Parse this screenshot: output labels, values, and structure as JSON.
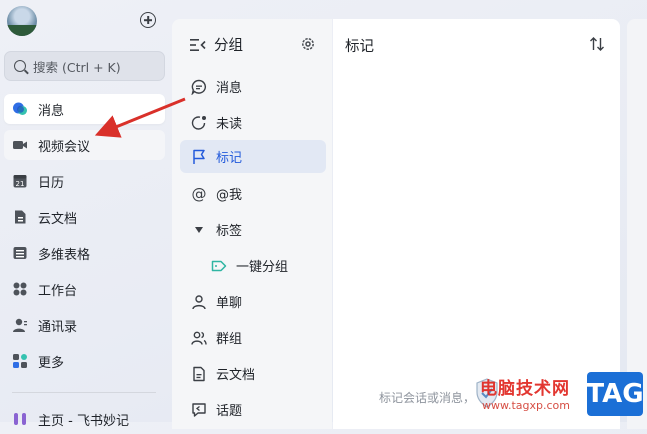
{
  "sidebar": {
    "search_placeholder": "搜索 (Ctrl + K)",
    "items": [
      {
        "label": "消息",
        "icon": "message-icon",
        "state": "active"
      },
      {
        "label": "视频会议",
        "icon": "video-meeting-icon",
        "state": "hover"
      },
      {
        "label": "日历",
        "icon": "calendar-icon",
        "state": ""
      },
      {
        "label": "云文档",
        "icon": "cloud-doc-icon",
        "state": ""
      },
      {
        "label": "多维表格",
        "icon": "base-table-icon",
        "state": ""
      },
      {
        "label": "工作台",
        "icon": "workplace-icon",
        "state": ""
      },
      {
        "label": "通讯录",
        "icon": "contacts-icon",
        "state": ""
      },
      {
        "label": "更多",
        "icon": "more-icon",
        "state": ""
      }
    ],
    "bottom_item": "主页 - 飞书妙记",
    "calendar_day": "21"
  },
  "groups": {
    "title": "分组",
    "items": [
      {
        "label": "消息",
        "icon": "chat-bubble-icon"
      },
      {
        "label": "未读",
        "icon": "unread-icon"
      },
      {
        "label": "标记",
        "icon": "flag-icon",
        "selected": true
      },
      {
        "label": "@我",
        "icon": "at-icon"
      },
      {
        "label": "标签",
        "icon": "caret-down-icon"
      },
      {
        "label": "一键分组",
        "icon": "tag-icon"
      },
      {
        "label": "单聊",
        "icon": "person-icon"
      },
      {
        "label": "群组",
        "icon": "group-icon"
      },
      {
        "label": "云文档",
        "icon": "document-icon"
      },
      {
        "label": "话题",
        "icon": "topic-icon"
      }
    ]
  },
  "content": {
    "title": "标记",
    "empty_hint": "标记会话或消息，"
  },
  "watermark": {
    "site": "电脑技术网",
    "url": "www.tagxp.com",
    "tag": "TAG"
  },
  "colors": {
    "accent": "#245bdb",
    "arrow": "#d9302a"
  }
}
